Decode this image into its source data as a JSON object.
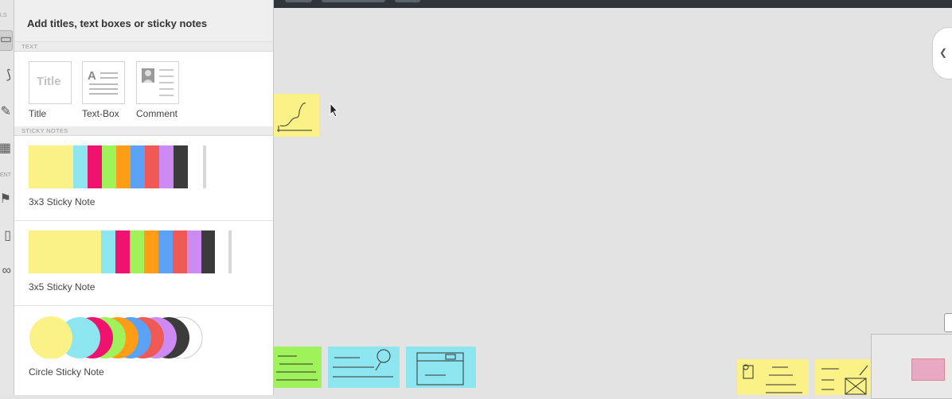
{
  "panel": {
    "title": "Add titles, text boxes or sticky notes",
    "section_text": "TEXT",
    "section_sticky": "STICKY NOTES",
    "text_items": [
      {
        "label": "Title",
        "preview": "Title"
      },
      {
        "label": "Text-Box",
        "preview": "A"
      },
      {
        "label": "Comment"
      }
    ],
    "sticky_items": [
      {
        "label": "3x3 Sticky Note"
      },
      {
        "label": "3x5 Sticky Note"
      },
      {
        "label": "Circle Sticky Note"
      }
    ],
    "note_colors": [
      "#fbf287",
      "#8de6ef",
      "#f0126f",
      "#9ff25a",
      "#ff9d17",
      "#5ba2f6",
      "#ef5a54",
      "#cd8af2",
      "#3b3b3b",
      "#ffffff"
    ]
  },
  "rail": {
    "labels": [
      "LS",
      "ENT"
    ],
    "tools": [
      "rectangle-tool",
      "connector-tool",
      "pen-tool",
      "grid-tool",
      "marker-tool",
      "phone-tool",
      "link-tool"
    ]
  },
  "canvas": {
    "notes": [
      {
        "name": "chart-sketch-note",
        "color": "#fbf287"
      },
      {
        "name": "green-sketch-note",
        "color": "#9ff25a"
      },
      {
        "name": "brainstorming-sketch-note",
        "color": "#8de6ef"
      },
      {
        "name": "landing-sketch-note",
        "color": "#8de6ef"
      },
      {
        "name": "columns-sketch-note",
        "color": "#fbf287"
      },
      {
        "name": "link-sketch-note",
        "color": "#fbf287"
      }
    ]
  },
  "icons": {
    "collapse": "chevron-left-icon",
    "cursor": "cursor-icon"
  }
}
